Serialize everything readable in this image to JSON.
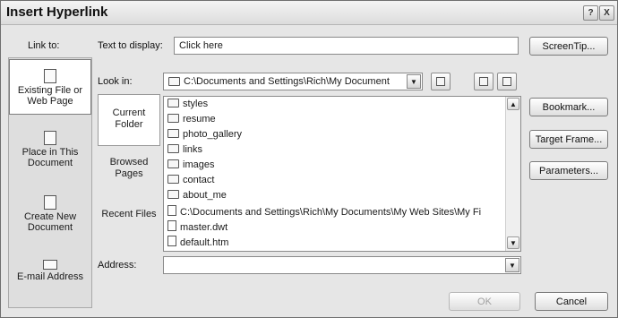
{
  "dialog": {
    "title": "Insert Hyperlink",
    "help_label": "?",
    "close_label": "X"
  },
  "link_to": {
    "label": "Link to:",
    "items": [
      {
        "label": "Existing File or Web Page",
        "icon": "file-globe-icon",
        "selected": true
      },
      {
        "label": "Place in This Document",
        "icon": "document-bookmark-icon",
        "selected": false
      },
      {
        "label": "Create New Document",
        "icon": "new-document-icon",
        "selected": false
      },
      {
        "label": "E-mail Address",
        "icon": "envelope-icon",
        "selected": false
      }
    ]
  },
  "text_to_display": {
    "label": "Text to display:",
    "value": "Click here"
  },
  "look_in": {
    "label": "Look in:",
    "value": "C:\\Documents and Settings\\Rich\\My Document"
  },
  "browse_tabs": [
    {
      "label": "Current Folder",
      "selected": true
    },
    {
      "label": "Browsed Pages",
      "selected": false
    },
    {
      "label": "Recent Files",
      "selected": false
    }
  ],
  "files": [
    {
      "name": "styles",
      "type": "folder"
    },
    {
      "name": "resume",
      "type": "folder"
    },
    {
      "name": "photo_gallery",
      "type": "folder"
    },
    {
      "name": "links",
      "type": "folder"
    },
    {
      "name": "images",
      "type": "folder"
    },
    {
      "name": "contact",
      "type": "folder"
    },
    {
      "name": "about_me",
      "type": "folder"
    },
    {
      "name": "C:\\Documents and Settings\\Rich\\My Documents\\My Web Sites\\My Fi",
      "type": "file"
    },
    {
      "name": "master.dwt",
      "type": "file"
    },
    {
      "name": "default.htm",
      "type": "file"
    }
  ],
  "address": {
    "label": "Address:",
    "value": ""
  },
  "buttons": {
    "screentip": "ScreenTip...",
    "bookmark": "Bookmark...",
    "target_frame": "Target Frame...",
    "parameters": "Parameters...",
    "ok": "OK",
    "cancel": "Cancel"
  }
}
